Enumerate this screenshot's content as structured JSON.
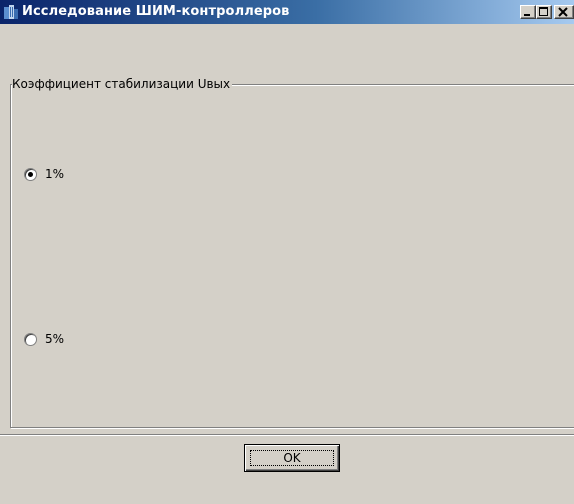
{
  "window": {
    "title": "Исследование ШИМ-контроллеров",
    "buttons": {
      "minimize_icon": "minimize-icon",
      "maximize_icon": "maximize-icon",
      "close_icon": "close-icon"
    }
  },
  "group": {
    "legend": "Коэффициент стабилизации Uвых",
    "options": [
      {
        "label": "1%",
        "selected": true
      },
      {
        "label": "5%",
        "selected": false
      }
    ]
  },
  "footer": {
    "ok_label": "OK"
  }
}
